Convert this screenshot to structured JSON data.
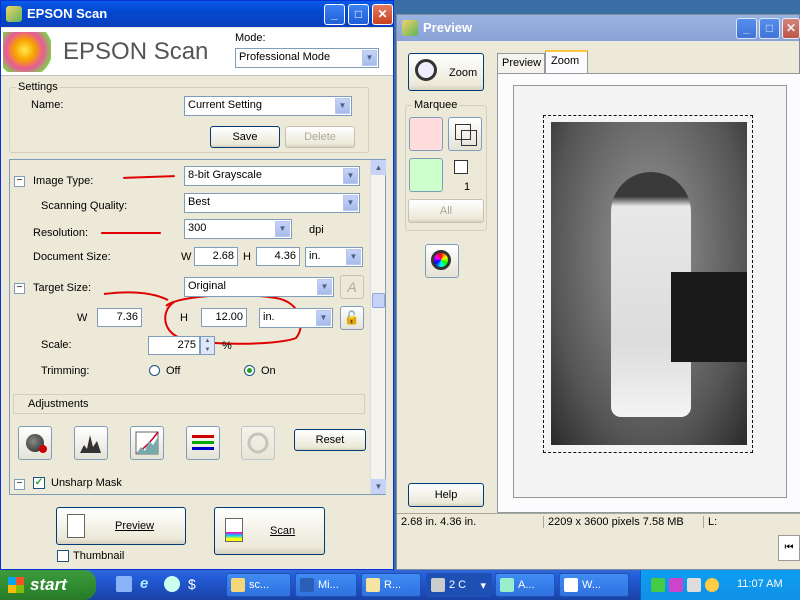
{
  "scan_window": {
    "title": "EPSON Scan",
    "logo_text": "EPSON Scan",
    "mode_label": "Mode:",
    "mode_value": "Professional Mode",
    "settings_group": "Settings",
    "name_label": "Name:",
    "name_value": "Current Setting",
    "save_label": "Save",
    "delete_label": "Delete",
    "image_type_label": "Image Type:",
    "image_type_value": "8-bit Grayscale",
    "quality_label": "Scanning Quality:",
    "quality_value": "Best",
    "resolution_label": "Resolution:",
    "resolution_value": "300",
    "dpi_label": "dpi",
    "doc_size_label": "Document Size:",
    "doc_w_label": "W",
    "doc_w_value": "2.68",
    "doc_h_label": "H",
    "doc_h_value": "4.36",
    "doc_unit": "in.",
    "target_size_label": "Target Size:",
    "target_size_value": "Original",
    "target_w_label": "W",
    "target_w_value": "7.36",
    "target_h_label": "H",
    "target_h_value": "12.00",
    "target_unit": "in.",
    "scale_label": "Scale:",
    "scale_value": "275",
    "scale_unit": "%",
    "trimming_label": "Trimming:",
    "trim_off_label": "Off",
    "trim_on_label": "On",
    "adjustments_label": "Adjustments",
    "reset_label": "Reset",
    "unsharp_label": "Unsharp Mask",
    "preview_label": "Preview",
    "scan_label": "Scan",
    "thumbnail_label": "Thumbnail"
  },
  "preview_window": {
    "title": "Preview",
    "zoom_button": "Zoom",
    "tab_preview": "Preview",
    "tab_zoom": "Zoom",
    "marquee_group": "Marquee",
    "marquee_count": "1",
    "all_label": "All",
    "help_label": "Help",
    "status_size": "2.68 in.   4.36 in.",
    "status_pixels": "2209 x 3600 pixels 7.58 MB",
    "status_l": "L:"
  },
  "taskbar": {
    "start_label": "start",
    "items": [
      "sc...",
      "Mi...",
      "R...",
      "2 C",
      "A...",
      "W..."
    ],
    "clock": "11:07 AM"
  }
}
